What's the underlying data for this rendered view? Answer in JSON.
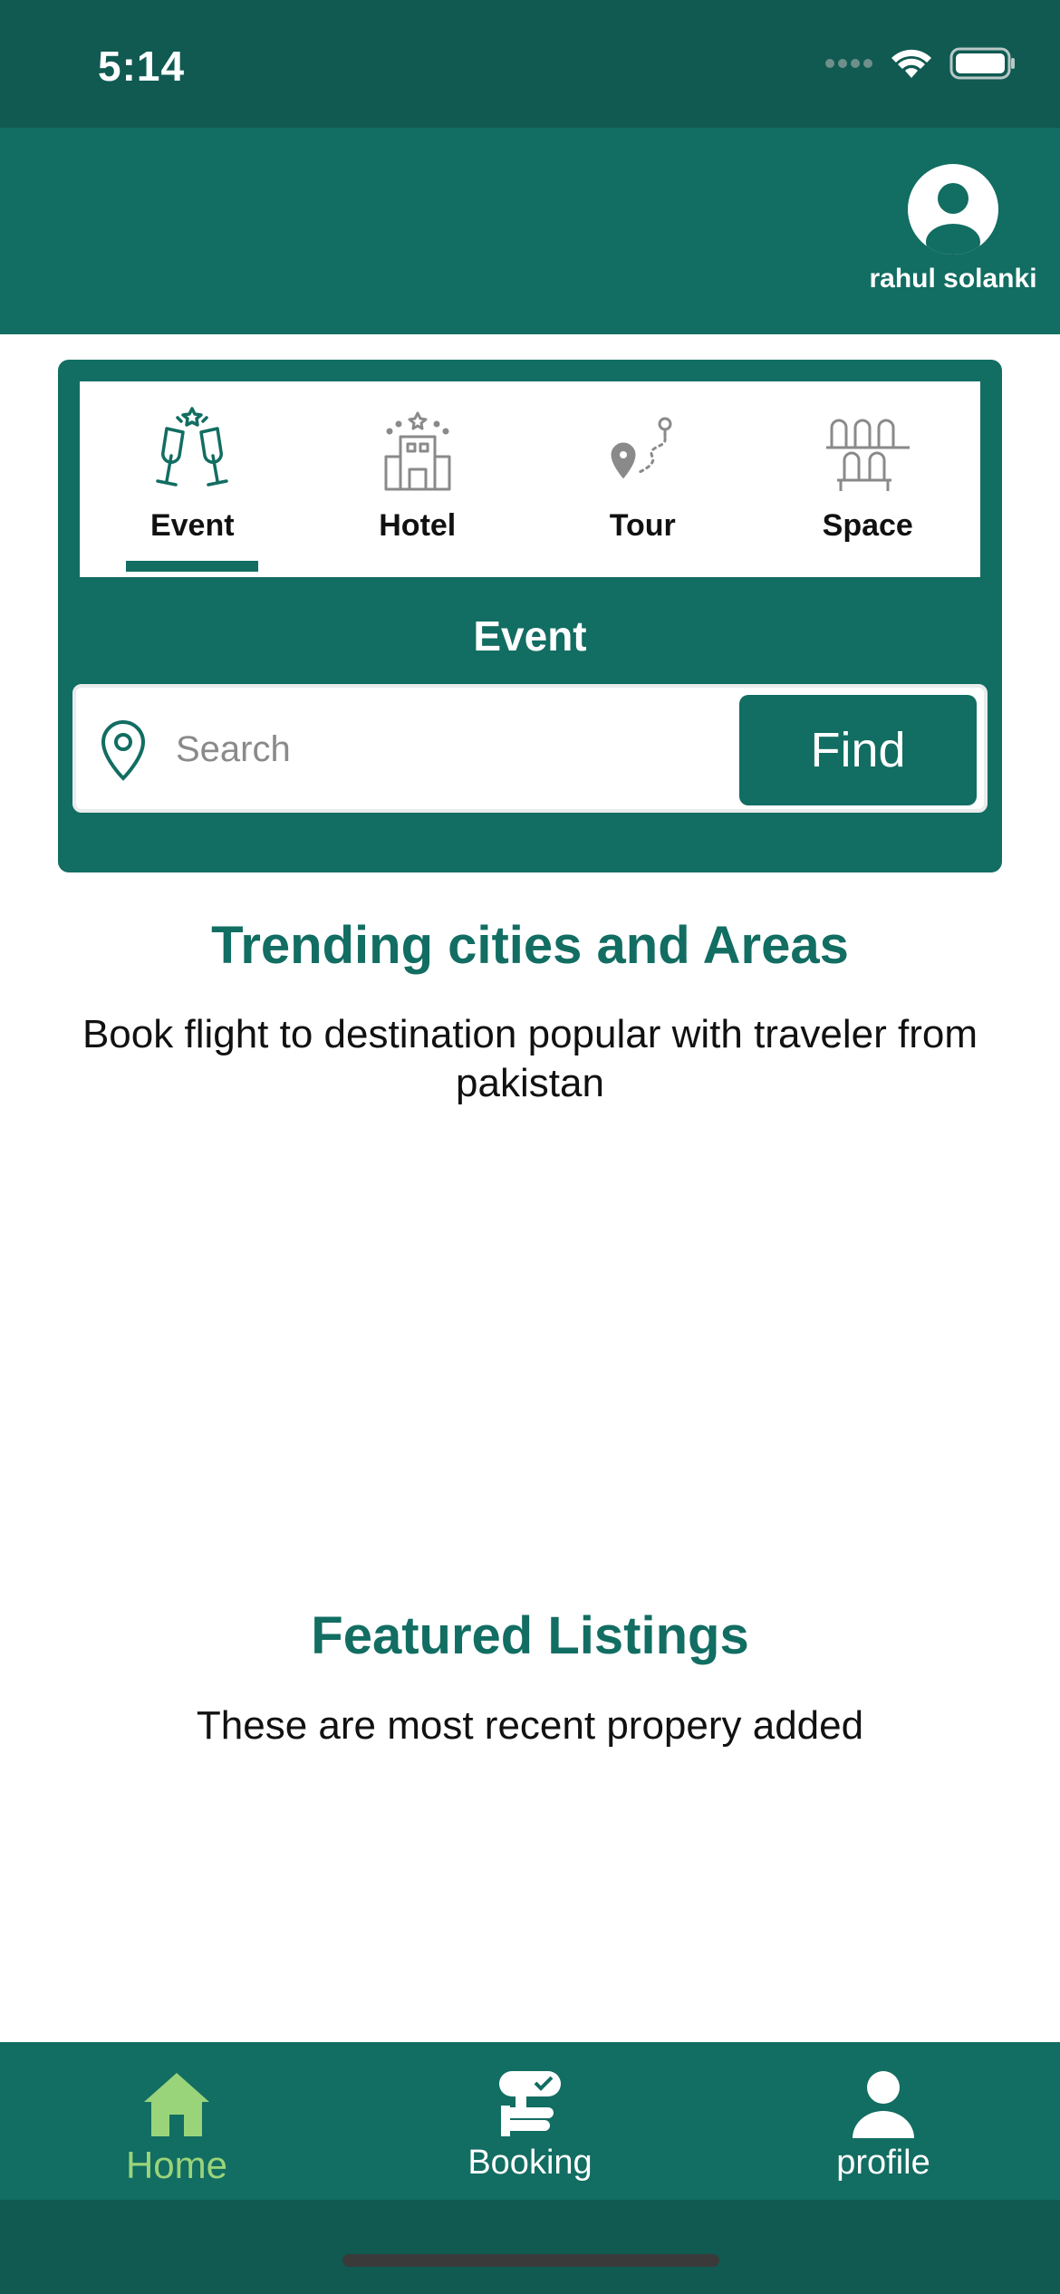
{
  "status_bar": {
    "time": "5:14",
    "icons": [
      "signal-icon",
      "wifi-icon",
      "battery-icon"
    ]
  },
  "header": {
    "user_name": "rahul solanki",
    "avatar_icon": "user-avatar-icon"
  },
  "search_card": {
    "tabs": [
      {
        "label": "Event",
        "icon": "champagne-glasses-icon",
        "active": true
      },
      {
        "label": "Hotel",
        "icon": "hotel-building-icon",
        "active": false
      },
      {
        "label": "Tour",
        "icon": "tour-route-icon",
        "active": false
      },
      {
        "label": "Space",
        "icon": "seats-icon",
        "active": false
      }
    ],
    "title": "Event",
    "search_placeholder": "Search",
    "find_label": "Find"
  },
  "trending": {
    "title": "Trending cities and Areas",
    "subtitle": "Book flight to destination popular with traveler from pakistan"
  },
  "featured": {
    "title": "Featured Listings",
    "subtitle": "These are most recent propery added"
  },
  "bottom_nav": [
    {
      "label": "Home",
      "icon": "home-icon",
      "active": true
    },
    {
      "label": "Booking",
      "icon": "booking-hand-icon",
      "active": false
    },
    {
      "label": "profile",
      "icon": "profile-person-icon",
      "active": false
    }
  ],
  "colors": {
    "primary": "#126d62",
    "status": "#105a52",
    "active_nav": "#9ad47a"
  }
}
